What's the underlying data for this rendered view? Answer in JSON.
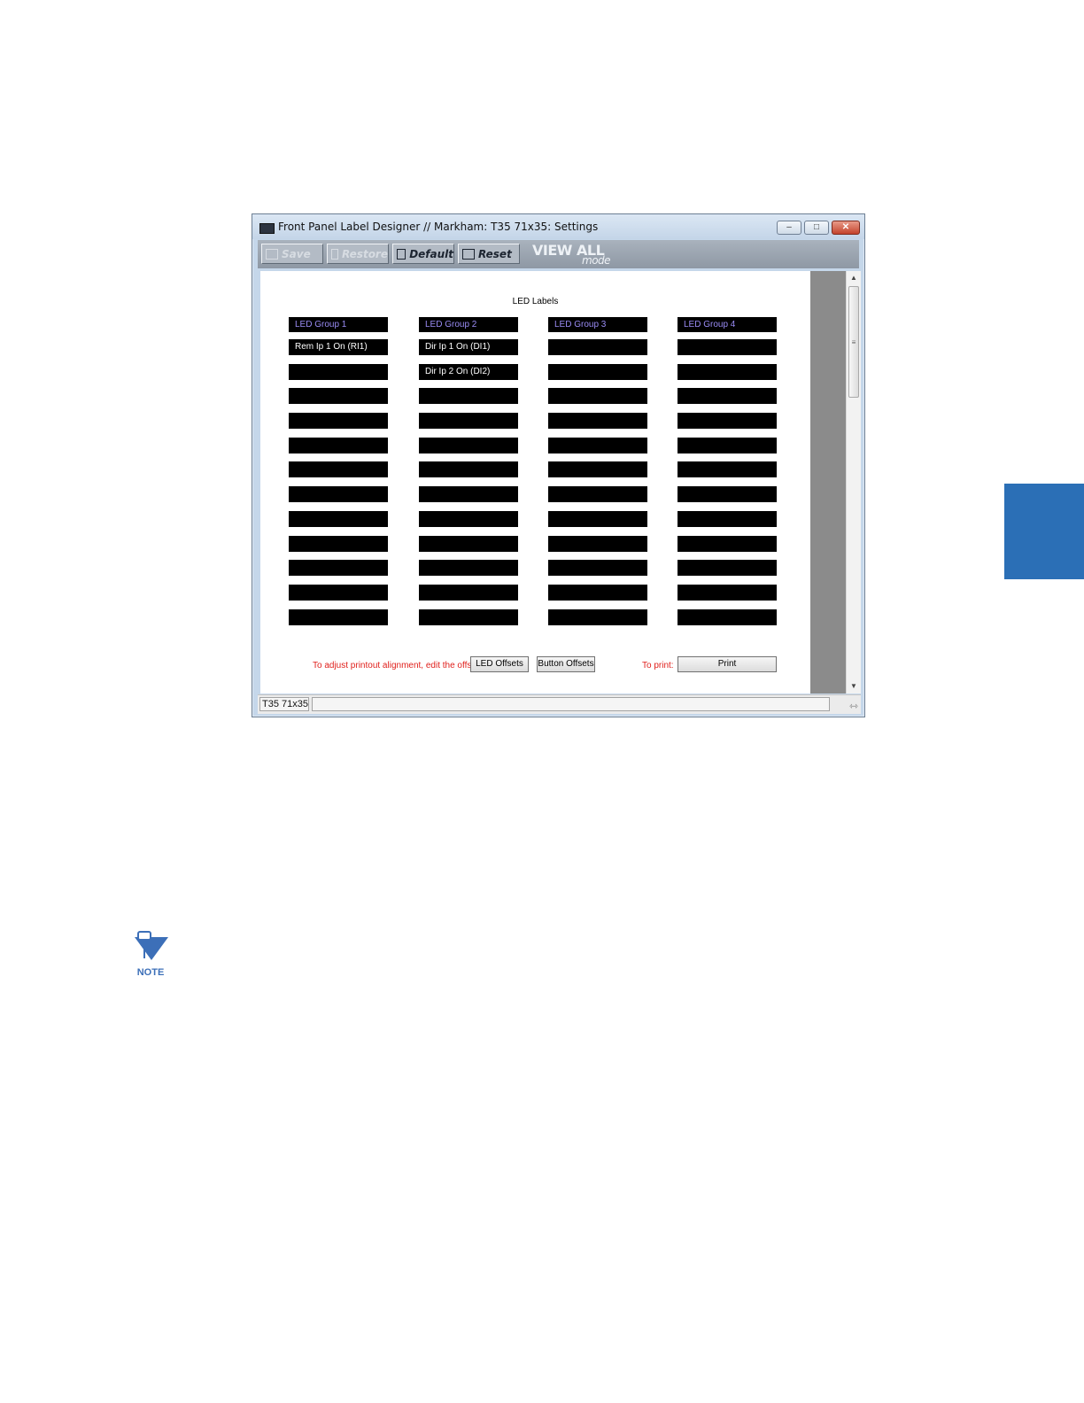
{
  "window": {
    "title": "Front Panel Label Designer // Markham: T35 71x35: Settings",
    "controls": {
      "minimize": "–",
      "maximize": "□",
      "close": "✕"
    }
  },
  "toolbar": {
    "save_label": "Save",
    "restore_label": "Restore",
    "default_label": "Default",
    "reset_label": "Reset",
    "view_all": "VIEW ALL",
    "mode": "mode"
  },
  "content": {
    "title": "LED Labels",
    "groups": [
      {
        "header": "LED Group 1",
        "cells": [
          "Rem Ip 1 On (RI1)",
          "",
          "",
          "",
          "",
          "",
          "",
          "",
          "",
          "",
          "",
          ""
        ]
      },
      {
        "header": "LED Group 2",
        "cells": [
          "Dir Ip 1 On (DI1)",
          "Dir Ip 2 On (DI2)",
          "",
          "",
          "",
          "",
          "",
          "",
          "",
          "",
          "",
          ""
        ]
      },
      {
        "header": "LED Group 3",
        "cells": [
          "",
          "",
          "",
          "",
          "",
          "",
          "",
          "",
          "",
          "",
          "",
          ""
        ]
      },
      {
        "header": "LED Group 4",
        "cells": [
          "",
          "",
          "",
          "",
          "",
          "",
          "",
          "",
          "",
          "",
          "",
          ""
        ]
      }
    ],
    "adjust_text": "To adjust printout alignment, edit the offsets:",
    "led_offsets_label": "LED Offsets",
    "button_offsets_label": "Button Offsets",
    "print_prompt": "To print:",
    "print_label": "Print"
  },
  "statusbar": {
    "device": "T35 71x35"
  },
  "note_icon": {
    "label": "NOTE"
  },
  "colors": {
    "side_tab": "#2b6fb6",
    "header_text": "#9a8cf5",
    "red_text": "#e0201c"
  }
}
